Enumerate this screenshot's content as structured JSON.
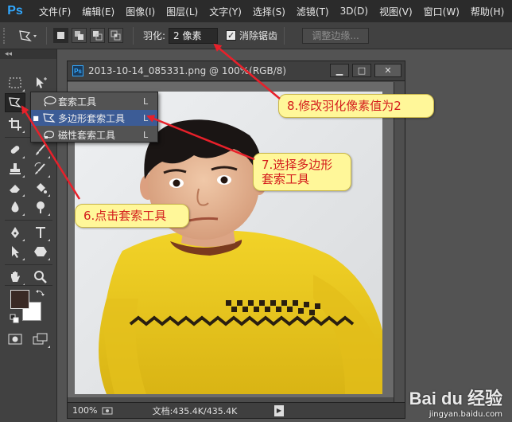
{
  "app": {
    "logo": "Ps"
  },
  "menu": [
    "文件(F)",
    "编辑(E)",
    "图像(I)",
    "图层(L)",
    "文字(Y)",
    "选择(S)",
    "滤镜(T)",
    "3D(D)",
    "视图(V)",
    "窗口(W)",
    "帮助(H)"
  ],
  "options": {
    "feather_label": "羽化:",
    "feather_value": "2 像素",
    "antialias_label": "消除锯齿",
    "antialias_checked": "✓",
    "refine_edge_label": "调整边缘..."
  },
  "toolbar": {
    "collapse": "◂◂"
  },
  "flyout": {
    "items": [
      {
        "label": "套索工具",
        "key": "L",
        "icon": "lasso-icon"
      },
      {
        "label": "多边形套索工具",
        "key": "L",
        "icon": "polygonal-lasso-icon",
        "selected_mark": "■"
      },
      {
        "label": "磁性套索工具",
        "key": "L",
        "icon": "magnetic-lasso-icon"
      }
    ]
  },
  "document": {
    "icon": "Ps",
    "title": "2013-10-14_085331.png @ 100%(RGB/8)",
    "min_glyph": "▁",
    "max_glyph": "□",
    "close_glyph": "✕",
    "zoom": "100%",
    "doc_info": "文档:435.4K/435.4K",
    "status_arrow": "▶"
  },
  "callouts": {
    "step8": "8.修改羽化像素值为2",
    "step7": "7.选择多边形\n套索工具",
    "step6": "6.点击套索工具"
  },
  "watermark": {
    "logo": "Bai du 经验",
    "url": "jingyan.baidu.com"
  },
  "colors": {
    "accent": "#31a8ff",
    "callout_bg": "#fff799",
    "callout_text": "#d41c1c",
    "arrow": "#e8202a",
    "foreground": "#3a2a25",
    "background": "#ffffff"
  }
}
